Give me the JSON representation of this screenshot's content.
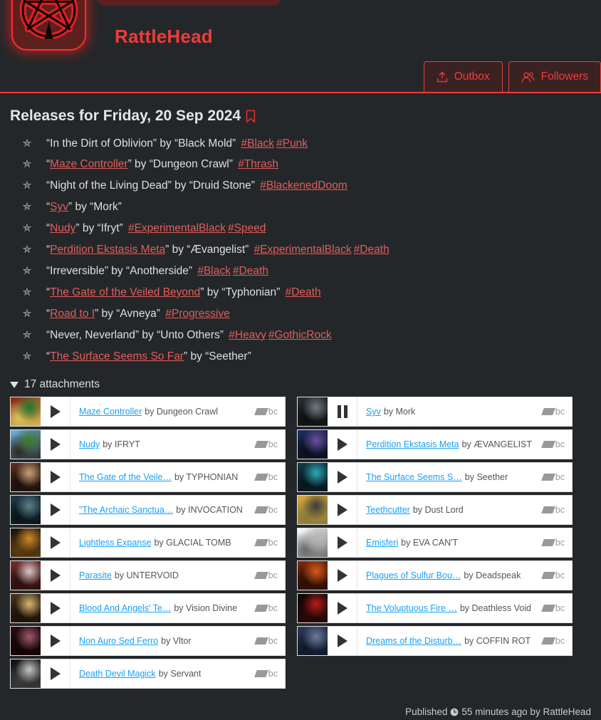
{
  "header": {
    "site_name": "RattleHead",
    "avatar_icon": "pentagram-logo",
    "buttons": [
      {
        "label": "Outbox",
        "icon": "outbox-upload-icon"
      },
      {
        "label": "Followers",
        "icon": "followers-people-icon"
      }
    ]
  },
  "page": {
    "title": "Releases for Friday, 20 Sep 2024",
    "bookmark_icon": "bookmark-icon",
    "bullet_icon": "pentagram-star-icon"
  },
  "releases": [
    {
      "quote_open": "“",
      "title": "In the Dirt of Oblivion",
      "title_link": false,
      "quote_close": "”",
      "by": "by “Black Mold”",
      "tags": [
        "#Black",
        "#Punk"
      ]
    },
    {
      "quote_open": "“",
      "title": "Maze Controller",
      "title_link": true,
      "quote_close": "”",
      "by": "by “Dungeon Crawl”",
      "tags": [
        "#Thrash"
      ]
    },
    {
      "quote_open": "“",
      "title": "Night of the Living Dead",
      "title_link": false,
      "quote_close": "”",
      "by": "by “Druid Stone”",
      "tags": [
        "#BlackenedDoom"
      ]
    },
    {
      "quote_open": "“",
      "title": "Syv",
      "title_link": true,
      "quote_close": "”",
      "by": "by “Mork”",
      "tags": []
    },
    {
      "quote_open": "“",
      "title": "Nudy",
      "title_link": true,
      "quote_close": "”",
      "by": "by “Ifryt”",
      "tags": [
        "#ExperimentalBlack",
        "#Speed"
      ]
    },
    {
      "quote_open": "“",
      "title": "Perdition Ekstasis Meta",
      "title_link": true,
      "quote_close": "”",
      "by": "by “Ævangelist”",
      "tags": [
        "#ExperimentalBlack",
        "#Death"
      ]
    },
    {
      "quote_open": "“",
      "title": "Irreversible",
      "title_link": false,
      "quote_close": "”",
      "by": "by “Anotherside”",
      "tags": [
        "#Black",
        "#Death"
      ]
    },
    {
      "quote_open": "“",
      "title": "The Gate of the Veiled Beyond",
      "title_link": true,
      "quote_close": "”",
      "by": "by “Typhonian”",
      "tags": [
        "#Death"
      ]
    },
    {
      "quote_open": "“",
      "title": "Road to I",
      "title_link": true,
      "quote_close": "”",
      "by": "by “Avneya”",
      "tags": [
        "#Progressive"
      ]
    },
    {
      "quote_open": "“",
      "title": "Never, Neverland",
      "title_link": false,
      "quote_close": "”",
      "by": "by “Unto Others”",
      "tags": [
        "#Heavy",
        "#GothicRock"
      ]
    },
    {
      "quote_open": "“",
      "title": "The Surface Seems So Far",
      "title_link": true,
      "quote_close": "”",
      "by": "by “Seether”",
      "tags": []
    }
  ],
  "attachments": {
    "toggle_label": "17 attachments",
    "count": 17,
    "logo_text": "bc",
    "items": [
      {
        "track": "Maze Controller",
        "by": "by Dungeon Crawl",
        "state": "play",
        "art": [
          "#8f1b12",
          "#1f7a2e",
          "#d8c35a"
        ]
      },
      {
        "track": "Syv",
        "by": "by Mork",
        "state": "pause",
        "art": [
          "#2b2f33",
          "#717a80",
          "#0d0f11"
        ]
      },
      {
        "track": "Nudy",
        "by": "by IFRYT",
        "state": "play",
        "art": [
          "#6fb4e8",
          "#3f7b2a",
          "#2e2a26"
        ]
      },
      {
        "track": "Perdition Ekstasis Meta",
        "by": "by ÆVANGELIST",
        "state": "play",
        "art": [
          "#1b2f5e",
          "#6a4fa0",
          "#0a0e1c"
        ]
      },
      {
        "track": "The Gate of the Veile…",
        "by": "by TYPHONIAN",
        "state": "play",
        "art": [
          "#5b2f1d",
          "#c9a27a",
          "#1a0f0a"
        ]
      },
      {
        "track": "The Surface Seems S…",
        "by": "by Seether",
        "state": "play",
        "art": [
          "#0f3b44",
          "#2fa8b8",
          "#06161a"
        ]
      },
      {
        "track": "\"The Archaic Sanctua…",
        "by": "by INVOCATION",
        "state": "play",
        "art": [
          "#1d3a4a",
          "#5c7f8c",
          "#0a1418"
        ]
      },
      {
        "track": "Teethcutter",
        "by": "by Dust Lord",
        "state": "play",
        "art": [
          "#d7a93b",
          "#3a3a3a",
          "#8a7a3a"
        ]
      },
      {
        "track": "Lightless Expanse",
        "by": "by GLACIAL TOMB",
        "state": "play",
        "art": [
          "#1a1208",
          "#d18a2a",
          "#5a3a12"
        ]
      },
      {
        "track": "Emisferi",
        "by": "by EVA CAN'T",
        "state": "play",
        "art": [
          "#ffffff",
          "#b4b4b4",
          "#6a6a6a"
        ]
      },
      {
        "track": "Parasite",
        "by": "by UNTERVOID",
        "state": "play",
        "art": [
          "#7a2c2c",
          "#d8c8c8",
          "#2a0f0f"
        ]
      },
      {
        "track": "Plagues of Sulfur Bou…",
        "by": "by Deadspeak",
        "state": "play",
        "art": [
          "#7a2a10",
          "#d85a1a",
          "#2a0d04"
        ]
      },
      {
        "track": "Blood And Angels' Te…",
        "by": "by Vision Divine",
        "state": "play",
        "art": [
          "#4a3320",
          "#d8b870",
          "#1a1008"
        ]
      },
      {
        "track": "The Voluptuous Fire …",
        "by": "by Deathless Void",
        "state": "play",
        "art": [
          "#0a0505",
          "#b81c1c",
          "#2a0808"
        ]
      },
      {
        "track": "Non Auro Sed Ferro",
        "by": "by Vltor",
        "state": "play",
        "art": [
          "#2a0a12",
          "#a05a6a",
          "#100406"
        ]
      },
      {
        "track": "Dreams of the Disturb…",
        "by": "by COFFIN ROT",
        "state": "play",
        "art": [
          "#2a3a5a",
          "#6a7a9a",
          "#101828"
        ]
      },
      {
        "track": "Death Devil Magick",
        "by": "by Servant",
        "state": "play",
        "art": [
          "#101010",
          "#c8c8c8",
          "#3a3a3a"
        ]
      }
    ]
  },
  "footer": {
    "published_label": "Published",
    "clock_icon": "clock-icon",
    "time_text": "55 minutes ago by RattleHead"
  },
  "colors": {
    "accent_red": "#ef3b3b",
    "link_red": "#e25c5c",
    "bg": "#242729",
    "bc_blue": "#1a9ff5"
  }
}
